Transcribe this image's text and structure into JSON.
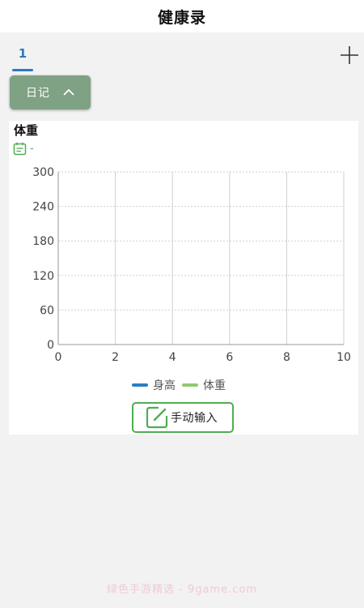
{
  "header": {
    "title": "健康录"
  },
  "tabs": [
    {
      "label": "1",
      "active": true
    }
  ],
  "add_tab_icon": "plus-icon",
  "diary_button": {
    "label": "日记",
    "icon": "chevron-up-icon"
  },
  "card": {
    "title": "体重",
    "date_icon": "calendar-icon",
    "date_text": "-"
  },
  "chart_data": {
    "type": "line",
    "title": "",
    "x": [],
    "xlim": [
      0,
      10
    ],
    "ylim": [
      0,
      300
    ],
    "x_ticks": [
      0,
      2,
      4,
      6,
      8,
      10
    ],
    "y_ticks": [
      0,
      60,
      120,
      180,
      240,
      300
    ],
    "series": [
      {
        "name": "身高",
        "values": [],
        "color": "#2a7fc1"
      },
      {
        "name": "体重",
        "values": [],
        "color": "#91c970"
      }
    ],
    "grid": true,
    "legend_placement": "bottom-center"
  },
  "manual_input_button": {
    "label": "手动输入",
    "icon": "edit-icon"
  },
  "watermark": "绿色手游精选 - 9game.com",
  "colors": {
    "accent_blue": "#2a79c2",
    "diary_button_bg": "#7fa184",
    "green_accent": "#4caf50"
  }
}
